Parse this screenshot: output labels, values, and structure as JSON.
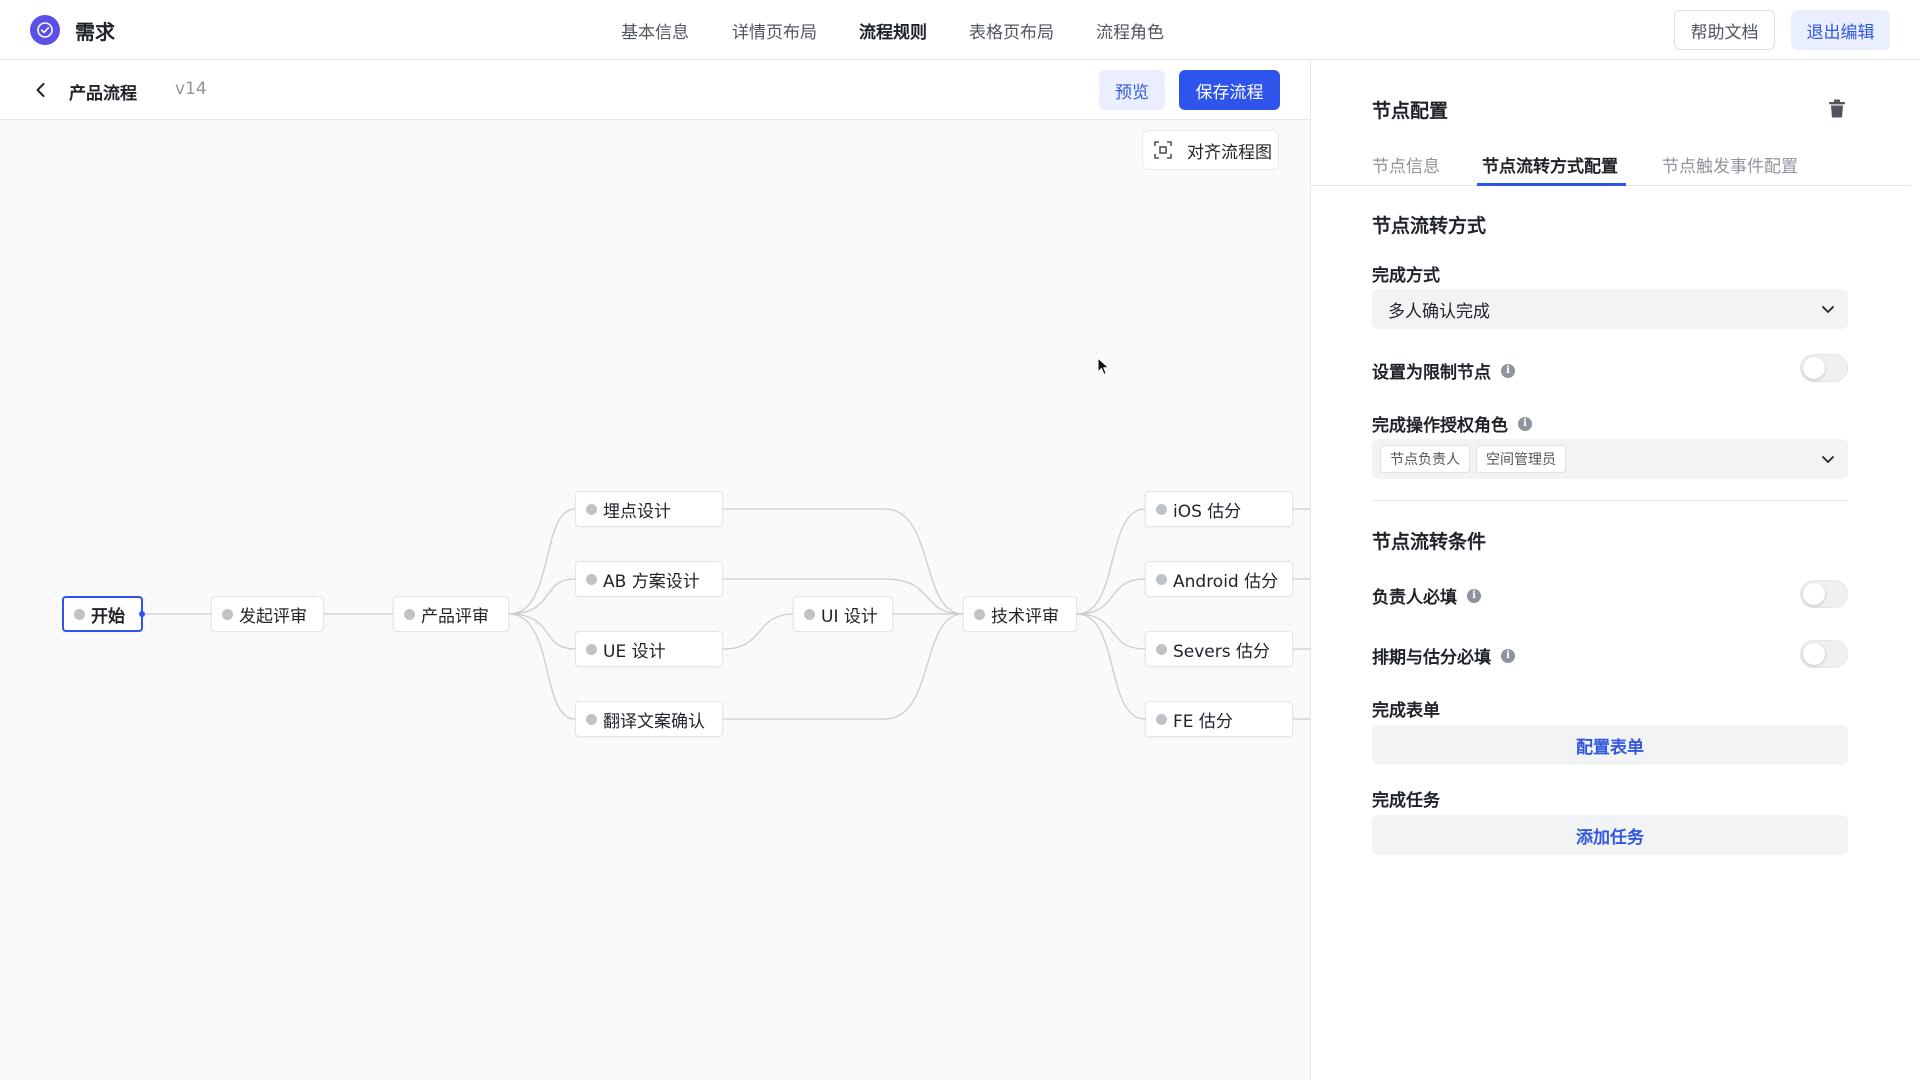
{
  "app": {
    "title": "需求",
    "logo_icon": "check-circle-icon",
    "brand_color": "#5b50e6"
  },
  "topnav": {
    "tabs": [
      {
        "label": "基本信息"
      },
      {
        "label": "详情页布局"
      },
      {
        "label": "流程规则",
        "active": true
      },
      {
        "label": "表格页布局"
      },
      {
        "label": "流程角色"
      }
    ],
    "help_label": "帮助文档",
    "exit_label": "退出编辑"
  },
  "subheader": {
    "back_icon": "chevron-left-icon",
    "flow_name": "产品流程",
    "version": "v14",
    "preview_label": "预览",
    "save_label": "保存流程",
    "accent_color": "#2f54eb"
  },
  "canvas": {
    "align_label": "对齐流程图",
    "align_icon": "focus-frame-icon",
    "nodes": [
      {
        "id": "start",
        "label": "开始",
        "selected": true
      },
      {
        "id": "initiate",
        "label": "发起评审"
      },
      {
        "id": "product",
        "label": "产品评审"
      },
      {
        "id": "tracking",
        "label": "埋点设计"
      },
      {
        "id": "ab",
        "label": "AB 方案设计"
      },
      {
        "id": "ue",
        "label": "UE 设计"
      },
      {
        "id": "translate",
        "label": "翻译文案确认"
      },
      {
        "id": "ui",
        "label": "UI 设计"
      },
      {
        "id": "tech",
        "label": "技术评审"
      },
      {
        "id": "ios",
        "label": "iOS 估分"
      },
      {
        "id": "android",
        "label": "Android 估分"
      },
      {
        "id": "severs",
        "label": "Severs 估分"
      },
      {
        "id": "fe",
        "label": "FE 估分"
      }
    ]
  },
  "panel": {
    "title": "节点配置",
    "delete_icon": "trash-icon",
    "tabs": [
      {
        "label": "节点信息"
      },
      {
        "label": "节点流转方式配置",
        "active": true
      },
      {
        "label": "节点触发事件配置"
      }
    ],
    "transition": {
      "section_title": "节点流转方式",
      "complete_mode_label": "完成方式",
      "complete_mode_value": "多人确认完成",
      "restrict_label": "设置为限制节点",
      "restrict_on": false,
      "roles_label": "完成操作授权角色",
      "roles": [
        "节点负责人",
        "空间管理员"
      ]
    },
    "conditions": {
      "section_title": "节点流转条件",
      "owner_required_label": "负责人必填",
      "owner_required_on": false,
      "schedule_required_label": "排期与估分必填",
      "schedule_required_on": false,
      "form_label": "完成表单",
      "form_button": "配置表单",
      "task_label": "完成任务",
      "task_button": "添加任务"
    }
  }
}
